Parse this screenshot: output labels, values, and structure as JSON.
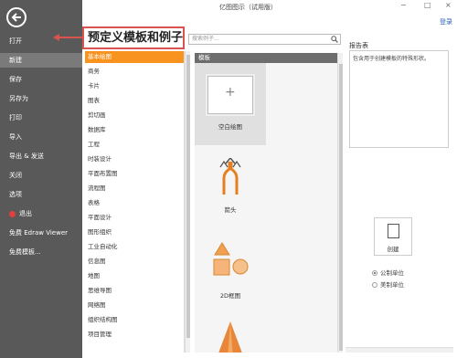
{
  "window": {
    "title": "亿图图示（试用版）",
    "login": "登录",
    "controls": [
      "−",
      "□",
      "×"
    ]
  },
  "sidebar": {
    "items": [
      {
        "label": "打开"
      },
      {
        "label": "新建"
      },
      {
        "label": "保存"
      },
      {
        "label": "另存为"
      },
      {
        "label": "打印"
      },
      {
        "label": "导入"
      },
      {
        "label": "导出 & 发送"
      },
      {
        "label": "关闭"
      },
      {
        "label": "选项"
      },
      {
        "label": "退出"
      },
      {
        "label": "免费 Edraw Viewer"
      },
      {
        "label": "免费模板..."
      }
    ]
  },
  "callout": {
    "text": "预定义模板和例子"
  },
  "search": {
    "placeholder": "搜索例子..."
  },
  "categories": [
    "基本绘图",
    "商务",
    "卡片",
    "图表",
    "剪切画",
    "数据库",
    "工程",
    "时装设计",
    "平面布置图",
    "流程图",
    "表格",
    "平面设计",
    "图形组织",
    "工业自动化",
    "信息图",
    "地图",
    "思维导图",
    "网络图",
    "组织结构图",
    "项目管理"
  ],
  "templates": {
    "header": "模板",
    "items": [
      {
        "label": "空白绘图"
      },
      {
        "label": "箭头"
      },
      {
        "label": "2D框图"
      }
    ]
  },
  "right_panel": {
    "title": "报告表",
    "description": "包含用于创建模板的特殊形状。",
    "create_label": "创建",
    "units": [
      {
        "label": "公制单位",
        "selected": true
      },
      {
        "label": "美制单位",
        "selected": false
      }
    ]
  },
  "colors": {
    "sidebar_bg": "#595959",
    "selected_category": "#f7931e",
    "callout_border": "#d9534f"
  }
}
